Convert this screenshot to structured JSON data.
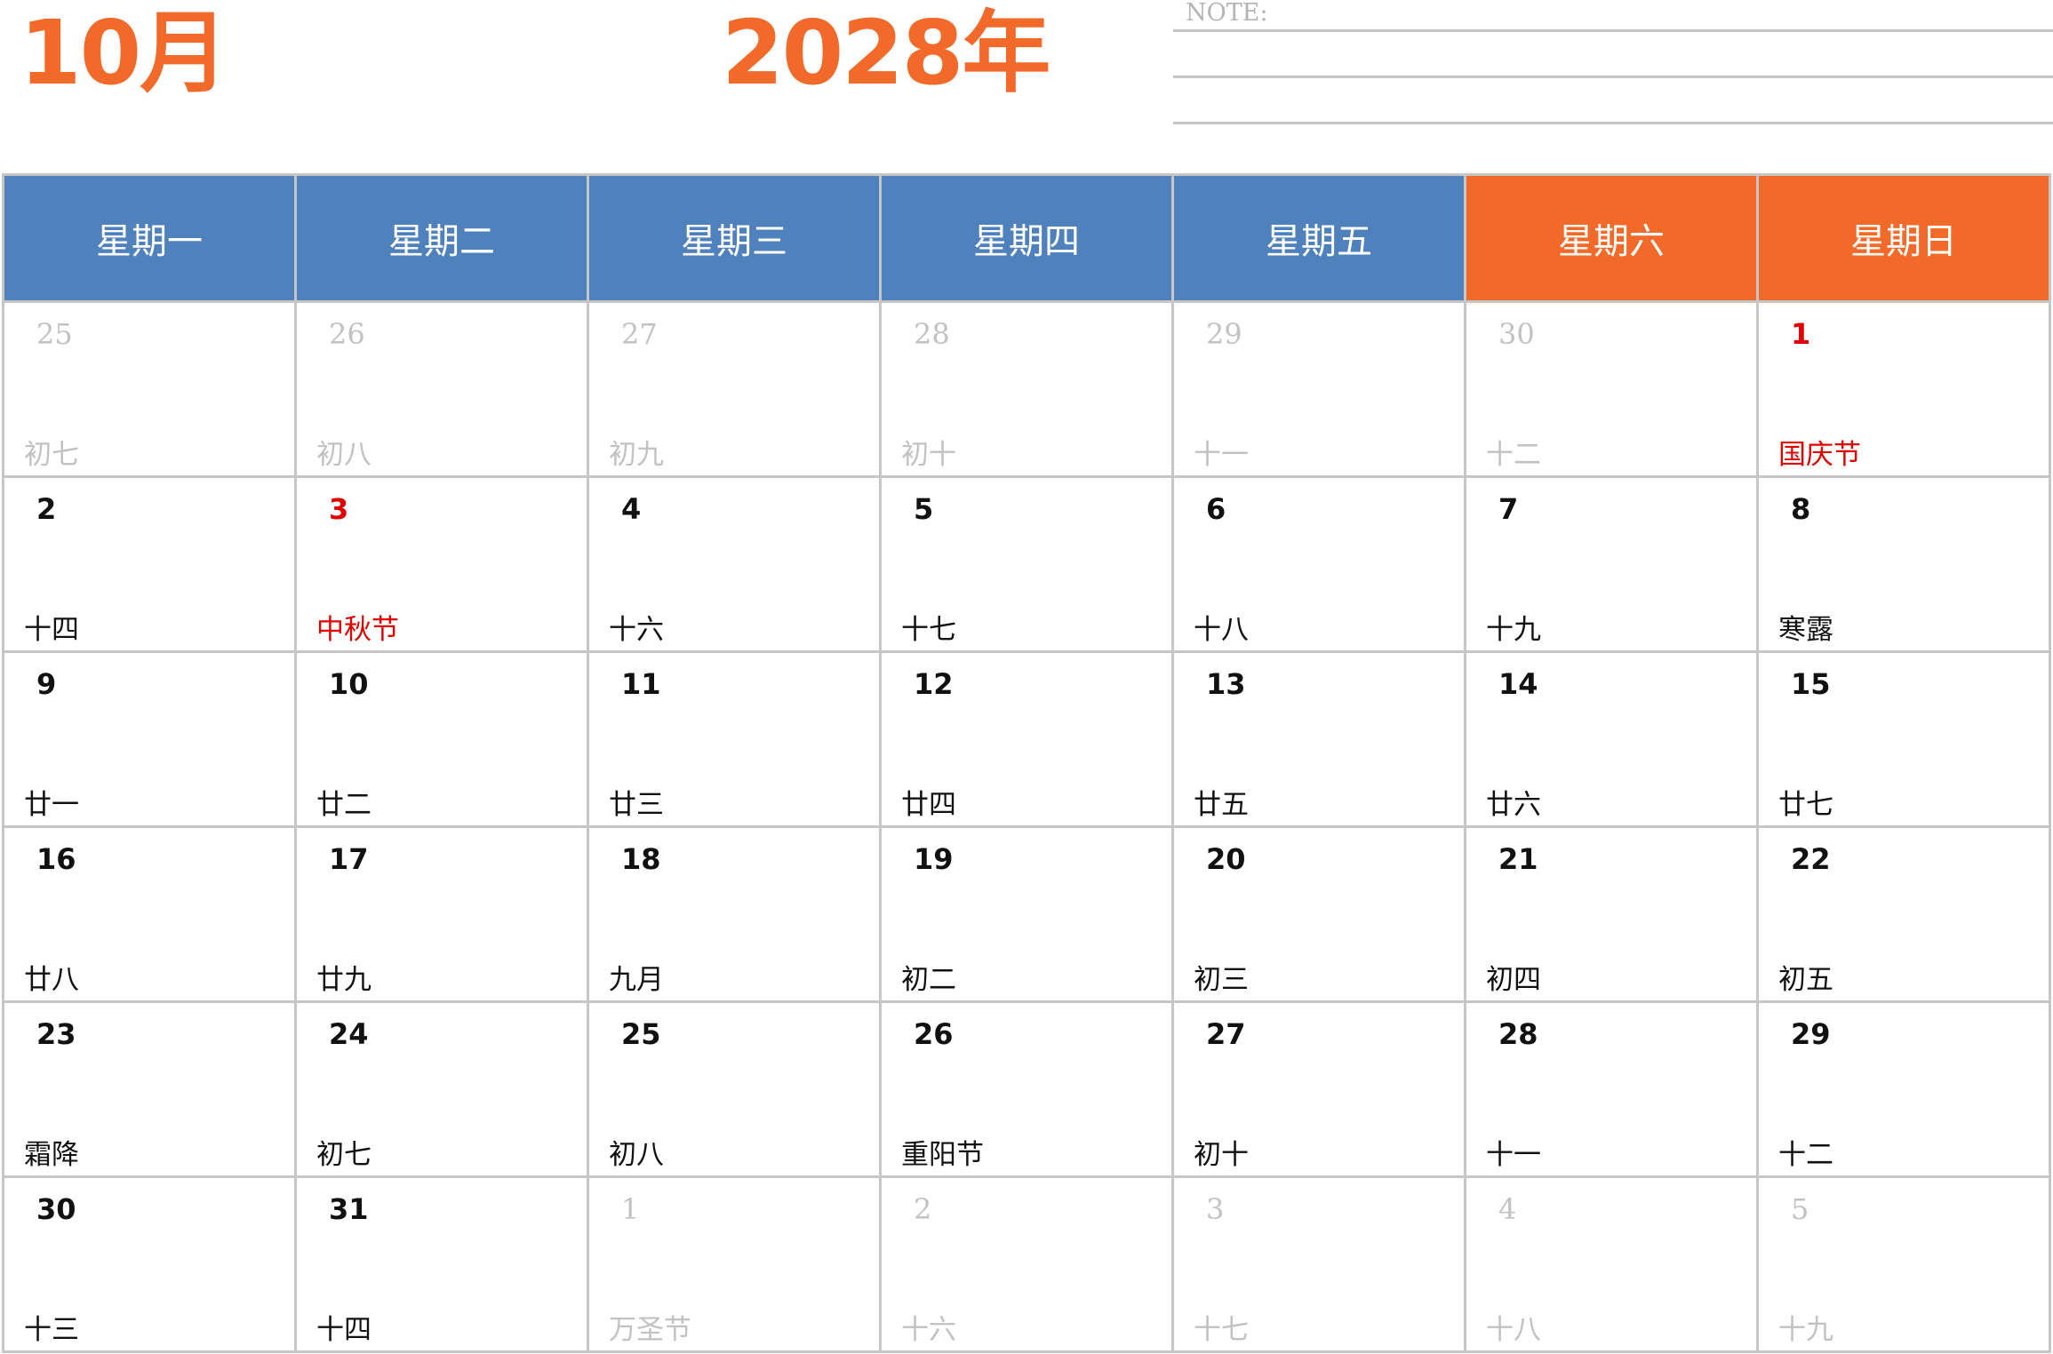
{
  "header": {
    "month": "10月",
    "year": "2028年",
    "note_label": "NOTE:"
  },
  "colors": {
    "accent": "#F26A2A",
    "weekday_header": "#4F81BD",
    "weekend_header": "#F26A2A",
    "holiday": "#E00000",
    "other_month": "#C2C2C2",
    "grid": "#C6C6C6"
  },
  "weekdays": [
    {
      "label": "星期一",
      "weekend": false
    },
    {
      "label": "星期二",
      "weekend": false
    },
    {
      "label": "星期三",
      "weekend": false
    },
    {
      "label": "星期四",
      "weekend": false
    },
    {
      "label": "星期五",
      "weekend": false
    },
    {
      "label": "星期六",
      "weekend": true
    },
    {
      "label": "星期日",
      "weekend": true
    }
  ],
  "days": [
    {
      "num": "25",
      "sub": "初七",
      "type": "other"
    },
    {
      "num": "26",
      "sub": "初八",
      "type": "other"
    },
    {
      "num": "27",
      "sub": "初九",
      "type": "other"
    },
    {
      "num": "28",
      "sub": "初十",
      "type": "other"
    },
    {
      "num": "29",
      "sub": "十一",
      "type": "other"
    },
    {
      "num": "30",
      "sub": "十二",
      "type": "other"
    },
    {
      "num": "1",
      "sub": "国庆节",
      "type": "holiday"
    },
    {
      "num": "2",
      "sub": "十四",
      "type": "normal"
    },
    {
      "num": "3",
      "sub": "中秋节",
      "type": "holiday"
    },
    {
      "num": "4",
      "sub": "十六",
      "type": "normal"
    },
    {
      "num": "5",
      "sub": "十七",
      "type": "normal"
    },
    {
      "num": "6",
      "sub": "十八",
      "type": "normal"
    },
    {
      "num": "7",
      "sub": "十九",
      "type": "normal"
    },
    {
      "num": "8",
      "sub": "寒露",
      "type": "normal"
    },
    {
      "num": "9",
      "sub": "廿一",
      "type": "normal"
    },
    {
      "num": "10",
      "sub": "廿二",
      "type": "normal"
    },
    {
      "num": "11",
      "sub": "廿三",
      "type": "normal"
    },
    {
      "num": "12",
      "sub": "廿四",
      "type": "normal"
    },
    {
      "num": "13",
      "sub": "廿五",
      "type": "normal"
    },
    {
      "num": "14",
      "sub": "廿六",
      "type": "normal"
    },
    {
      "num": "15",
      "sub": "廿七",
      "type": "normal"
    },
    {
      "num": "16",
      "sub": "廿八",
      "type": "normal"
    },
    {
      "num": "17",
      "sub": "廿九",
      "type": "normal"
    },
    {
      "num": "18",
      "sub": "九月",
      "type": "normal"
    },
    {
      "num": "19",
      "sub": "初二",
      "type": "normal"
    },
    {
      "num": "20",
      "sub": "初三",
      "type": "normal"
    },
    {
      "num": "21",
      "sub": "初四",
      "type": "normal"
    },
    {
      "num": "22",
      "sub": "初五",
      "type": "normal"
    },
    {
      "num": "23",
      "sub": "霜降",
      "type": "normal"
    },
    {
      "num": "24",
      "sub": "初七",
      "type": "normal"
    },
    {
      "num": "25",
      "sub": "初八",
      "type": "normal"
    },
    {
      "num": "26",
      "sub": "重阳节",
      "type": "normal"
    },
    {
      "num": "27",
      "sub": "初十",
      "type": "normal"
    },
    {
      "num": "28",
      "sub": "十一",
      "type": "normal"
    },
    {
      "num": "29",
      "sub": "十二",
      "type": "normal"
    },
    {
      "num": "30",
      "sub": "十三",
      "type": "normal"
    },
    {
      "num": "31",
      "sub": "十四",
      "type": "normal"
    },
    {
      "num": "1",
      "sub": "万圣节",
      "type": "other"
    },
    {
      "num": "2",
      "sub": "十六",
      "type": "other"
    },
    {
      "num": "3",
      "sub": "十七",
      "type": "other"
    },
    {
      "num": "4",
      "sub": "十八",
      "type": "other"
    },
    {
      "num": "5",
      "sub": "十九",
      "type": "other"
    }
  ]
}
